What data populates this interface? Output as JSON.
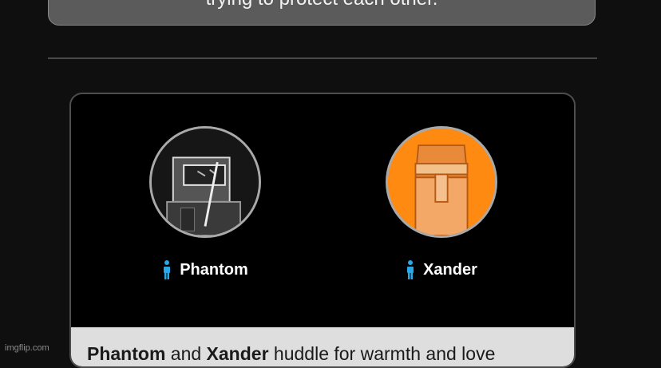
{
  "top_card": {
    "text": "trying to protect each other."
  },
  "players": [
    {
      "name": "Phantom",
      "avatar_bg": "#1b1b1b",
      "icon": "person-icon"
    },
    {
      "name": "Xander",
      "avatar_bg": "#ff8a12",
      "icon": "person-icon"
    }
  ],
  "caption": {
    "name1": "Phantom",
    "text1": " and ",
    "name2": "Xander",
    "text2": " huddle for warmth and love"
  },
  "watermark": "imgflip.com",
  "colors": {
    "person_icon": "#29a8e8",
    "card_bg": "#000000",
    "caption_bg": "#dedede"
  }
}
